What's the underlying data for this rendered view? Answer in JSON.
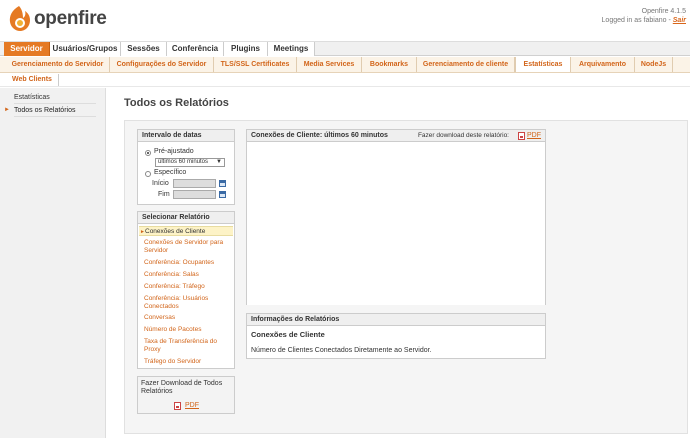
{
  "header": {
    "app_name": "openfire",
    "version": "Openfire 4.1.5",
    "logged_in_prefix": "Logged in as fabiano -",
    "logout_label": "Sair",
    "brand_color": "#e57a24"
  },
  "main_tabs": [
    {
      "label": "Servidor",
      "active": true
    },
    {
      "label": "Usuários/Grupos",
      "active": false
    },
    {
      "label": "Sessões",
      "active": false
    },
    {
      "label": "Conferência",
      "active": false
    },
    {
      "label": "Plugins",
      "active": false
    },
    {
      "label": "Meetings",
      "active": false
    }
  ],
  "sub_tabs": [
    {
      "label": "Gerenciamento do Servidor",
      "active": false
    },
    {
      "label": "Configurações do Servidor",
      "active": false
    },
    {
      "label": "TLS/SSL Certificates",
      "active": false
    },
    {
      "label": "Media Services",
      "active": false
    },
    {
      "label": "Bookmarks",
      "active": false
    },
    {
      "label": "Gerenciamento de cliente",
      "active": false
    },
    {
      "label": "Estatísticas",
      "active": true
    },
    {
      "label": "Arquivamento",
      "active": false
    },
    {
      "label": "NodeJs",
      "active": false
    }
  ],
  "third_tab": "Web Clients",
  "sidebar": {
    "items": [
      {
        "label": "Estatísticas",
        "active": false
      },
      {
        "label": "Todos os Relatórios",
        "active": true
      }
    ]
  },
  "page_title": "Todos os Relatórios",
  "date_panel": {
    "title": "Intervalo de datas",
    "preset_label": "Pré-ajustado",
    "preset_value": "últimos 60 minutos",
    "specific_label": "Específico",
    "start_label": "Início",
    "end_label": "Fim"
  },
  "report_panel": {
    "title": "Selecionar Relatório",
    "items": [
      {
        "label": "Conexões de Cliente",
        "active": true
      },
      {
        "label": "Conexões de Servidor para Servidor",
        "active": false
      },
      {
        "label": "Conferência: Ocupantes",
        "active": false
      },
      {
        "label": "Conferência: Salas",
        "active": false
      },
      {
        "label": "Conferência: Tráfego",
        "active": false
      },
      {
        "label": "Conferência: Usuários Conectados",
        "active": false
      },
      {
        "label": "Conversas",
        "active": false
      },
      {
        "label": "Número de Pacotes",
        "active": false
      },
      {
        "label": "Taxa de Transferência do Proxy",
        "active": false
      },
      {
        "label": "Tráfego do Servidor",
        "active": false
      }
    ]
  },
  "download_panel": {
    "title": "Fazer Download de Todos Relatórios",
    "pdf_label": "PDF"
  },
  "chart_panel": {
    "title": "Conexões de Cliente: últimos 60 minutos",
    "download_label": "Fazer download deste relatório:",
    "pdf_label": "PDF"
  },
  "info_panel": {
    "title": "Informações do Relatórios",
    "report_name": "Conexões de Cliente",
    "description": "Número de Clientes Conectados Diretamente ao Servidor."
  }
}
